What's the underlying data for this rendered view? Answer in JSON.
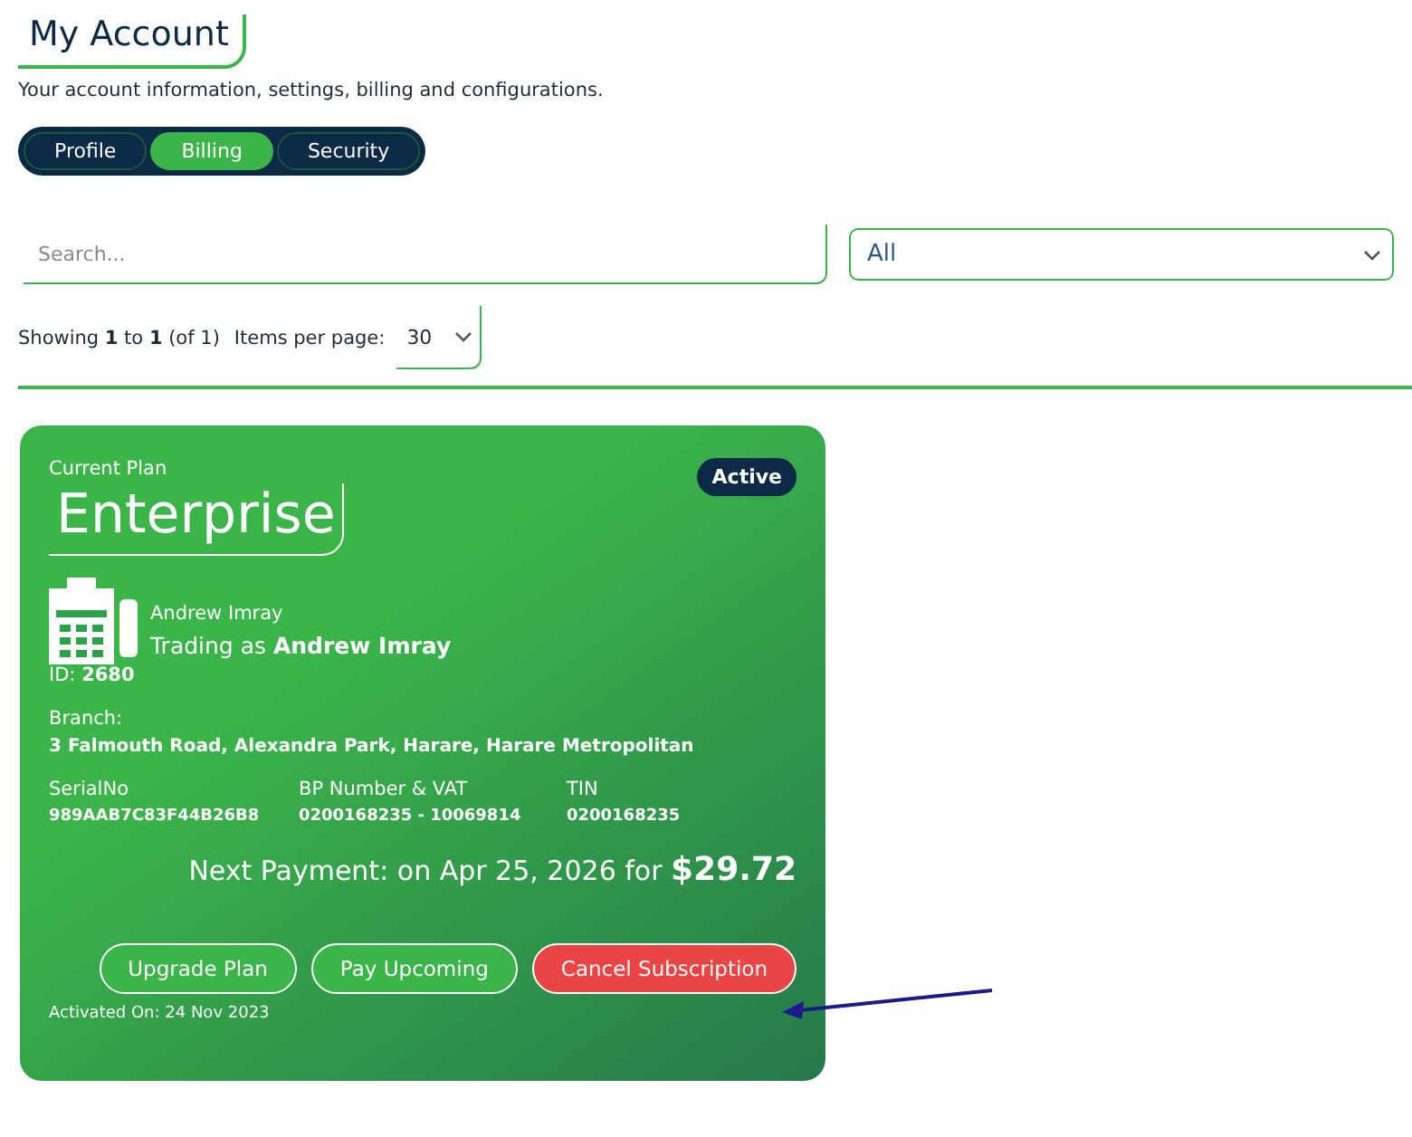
{
  "page": {
    "title": "My Account",
    "subtitle": "Your account information, settings, billing and configurations."
  },
  "tabs": [
    {
      "label": "Profile",
      "selected": false
    },
    {
      "label": "Billing",
      "selected": true
    },
    {
      "label": "Security",
      "selected": false
    }
  ],
  "filters": {
    "search": {
      "placeholder": "Search..."
    },
    "status_select": {
      "value": "All"
    }
  },
  "pagination": {
    "showing": "Showing **1** to **1** (of 1)",
    "items_per_page_label": "Items per page:",
    "items_per_page": "30"
  },
  "plan_card": {
    "label": "Current Plan",
    "plan": "Enterprise",
    "status": "Active",
    "name": "Andrew Imray",
    "trading": "Trading as **Andrew Imray**",
    "id": "ID: **2680**",
    "branch_label": "Branch:",
    "branch": "3 Falmouth Road, Alexandra Park, Harare, Harare Metropolitan",
    "fields": [
      {
        "label": "SerialNo",
        "value": "989AAB7C83F44B26B8"
      },
      {
        "label": "BP Number & VAT",
        "value": "0200168235 - 10069814"
      },
      {
        "label": "TIN",
        "value": "0200168235"
      }
    ],
    "next_payment": "Next Payment: on Apr 25, 2026 for **$29.72**",
    "buttons": [
      {
        "label": "Upgrade Plan",
        "kind": "outline"
      },
      {
        "label": "Pay Upcoming",
        "kind": "outline"
      },
      {
        "label": "Cancel Subscription",
        "kind": "danger"
      }
    ],
    "activated": "Activated On: 24 Nov 2023"
  }
}
